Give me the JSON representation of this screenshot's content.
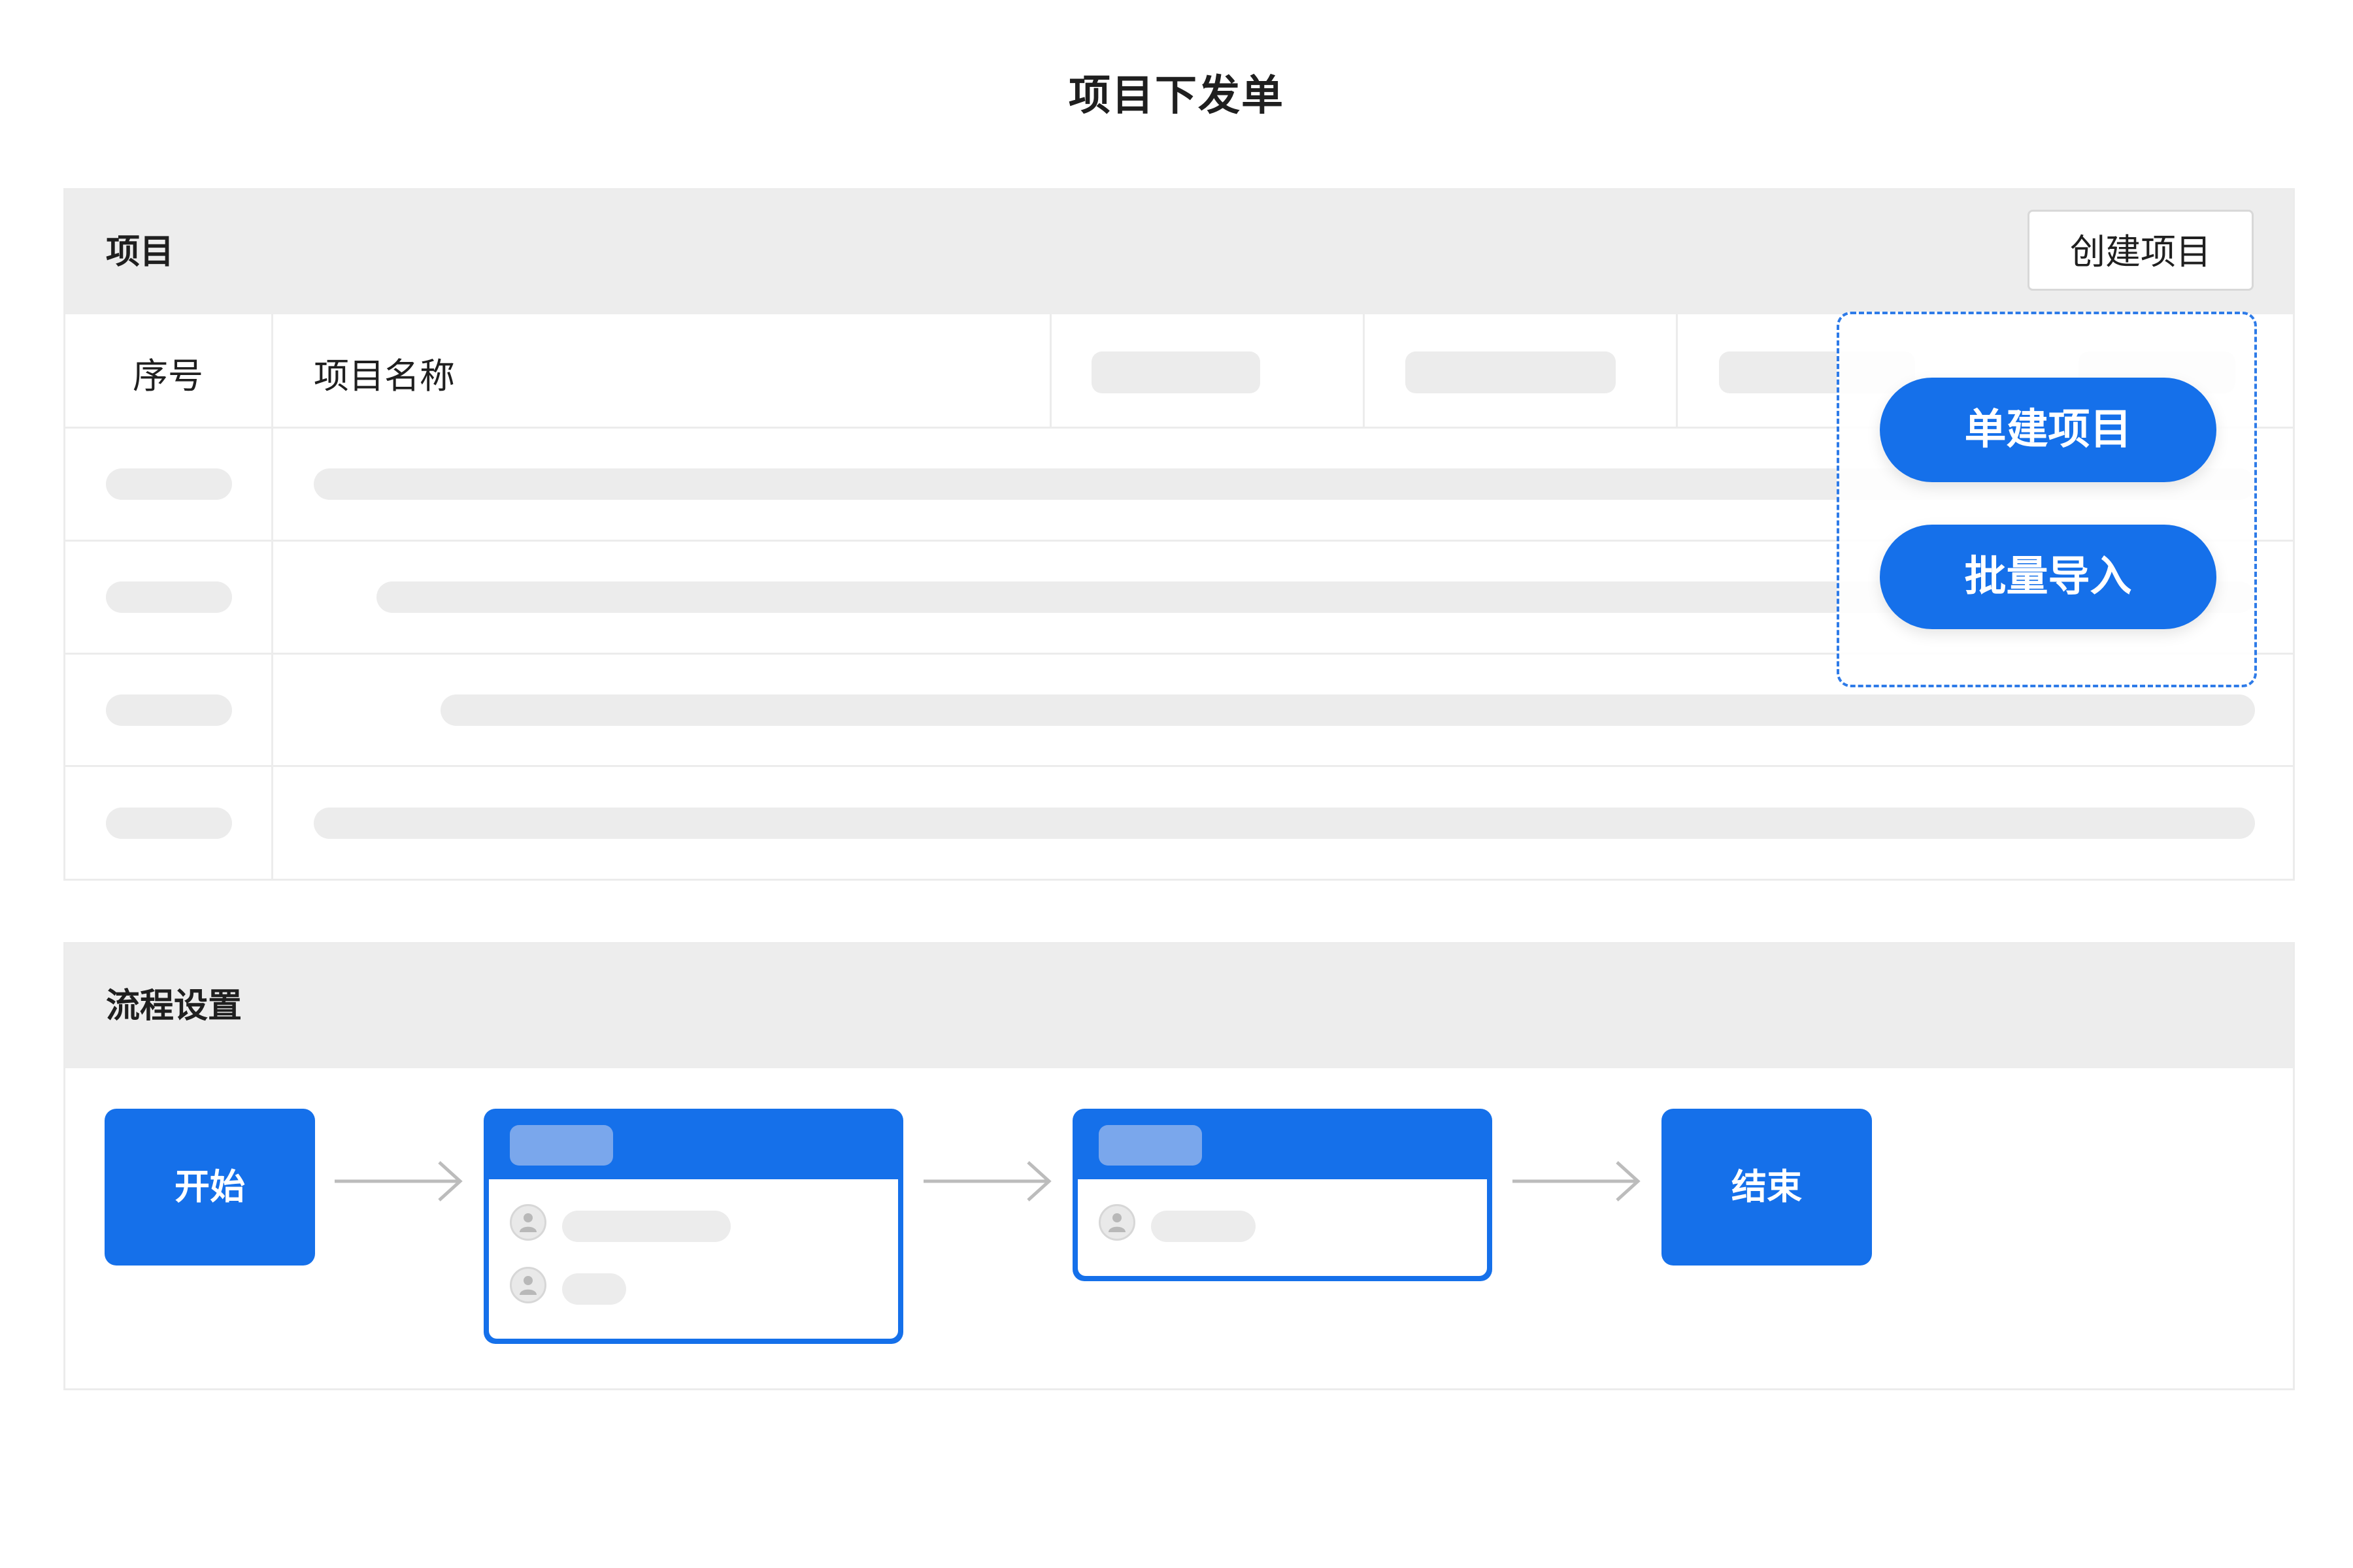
{
  "page": {
    "title": "项目下发单"
  },
  "project_section": {
    "title": "项目",
    "create_button": "创建项目",
    "columns": [
      "序号",
      "项目名称"
    ],
    "dropdown": {
      "items": [
        "单建项目",
        "批量导入"
      ]
    }
  },
  "flow_section": {
    "title": "流程设置",
    "start_label": "开始",
    "end_label": "结束"
  },
  "colors": {
    "accent": "#1570ea",
    "placeholder": "#ececec",
    "header_bg": "#ededed"
  }
}
